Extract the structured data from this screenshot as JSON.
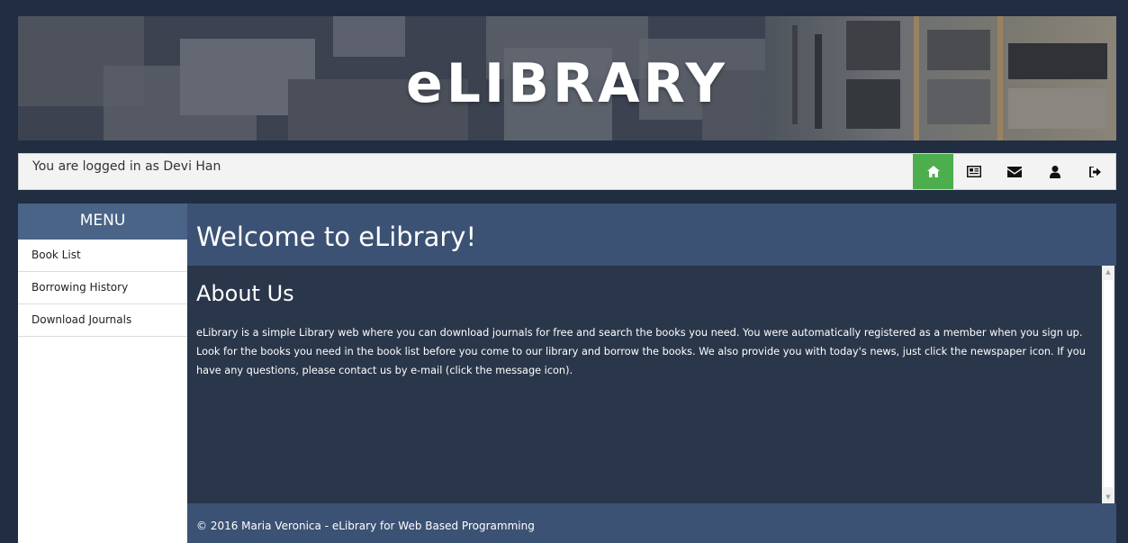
{
  "banner": {
    "title": "eLIBRARY"
  },
  "login": {
    "text": "You are logged in as Devi Han"
  },
  "nav_icons": [
    {
      "icon": "home-icon",
      "active": true
    },
    {
      "icon": "newspaper-icon",
      "active": false
    },
    {
      "icon": "envelope-icon",
      "active": false
    },
    {
      "icon": "user-icon",
      "active": false
    },
    {
      "icon": "sign-out-icon",
      "active": false
    }
  ],
  "colors": {
    "page_bg": "#212d40",
    "menu_header": "#4a6488",
    "main_header": "#3c5274",
    "content_bg": "#2a364a",
    "active_nav": "#4cae4c"
  },
  "sidebar": {
    "title": "MENU",
    "items": [
      {
        "label": "Book List"
      },
      {
        "label": "Borrowing History"
      },
      {
        "label": "Download Journals"
      }
    ]
  },
  "main": {
    "title": "Welcome to eLibrary!",
    "about_title": "About Us",
    "about_text": "eLibrary is a simple Library web where you can download journals for free and search the books you need. You were automatically registered as a member when you sign up. Look for the books you need in the book list before you come to our library and borrow the books. We also provide you with today's news, just click the newspaper icon. If you have any questions, please contact us by e-mail (click the message icon)."
  },
  "footer": {
    "text": "© 2016 Maria Veronica - eLibrary for Web Based Programming"
  }
}
